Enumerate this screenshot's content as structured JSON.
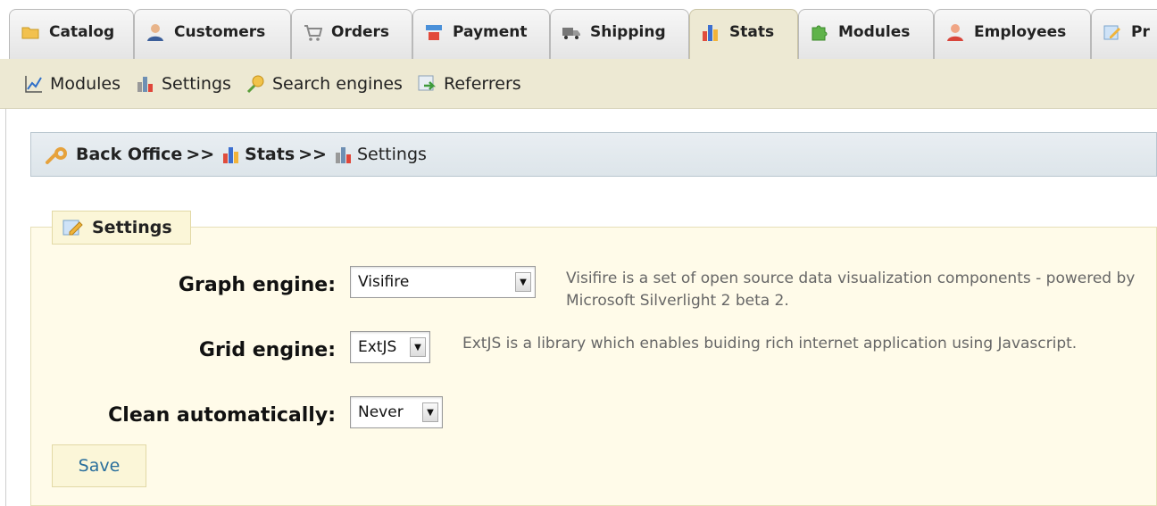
{
  "tabs": [
    {
      "label": "Catalog",
      "icon": "folder-icon"
    },
    {
      "label": "Customers",
      "icon": "customer-icon"
    },
    {
      "label": "Orders",
      "icon": "cart-icon"
    },
    {
      "label": "Payment",
      "icon": "payment-icon"
    },
    {
      "label": "Shipping",
      "icon": "truck-icon"
    },
    {
      "label": "Stats",
      "icon": "bar-chart-icon",
      "active": true
    },
    {
      "label": "Modules",
      "icon": "puzzle-icon"
    },
    {
      "label": "Employees",
      "icon": "employee-icon"
    },
    {
      "label": "Pr",
      "icon": "edit-note-icon"
    }
  ],
  "subnav": [
    {
      "label": "Modules",
      "icon": "line-chart-icon"
    },
    {
      "label": "Settings",
      "icon": "stats-settings-icon"
    },
    {
      "label": "Search engines",
      "icon": "search-engines-icon"
    },
    {
      "label": "Referrers",
      "icon": "referrers-icon"
    }
  ],
  "breadcrumb": {
    "root": "Back Office",
    "separator": ">>",
    "section": "Stats",
    "page": "Settings"
  },
  "form": {
    "legend": "Settings",
    "graph_engine": {
      "label": "Graph engine:",
      "value": "Visifire",
      "hint": "Visifire is a set of open source data visualization components - powered by Microsoft Silverlight 2 beta 2."
    },
    "grid_engine": {
      "label": "Grid engine:",
      "value": "ExtJS",
      "hint": "ExtJS is a library which enables buiding rich internet application using Javascript."
    },
    "clean": {
      "label": "Clean automatically:",
      "value": "Never"
    },
    "save_label": "Save"
  },
  "colors": {
    "subnav_bg": "#ede9d3",
    "breadcrumb_bg": "#e2e9ee",
    "panel_bg": "#fffbe9",
    "link": "#2a6f9c"
  }
}
